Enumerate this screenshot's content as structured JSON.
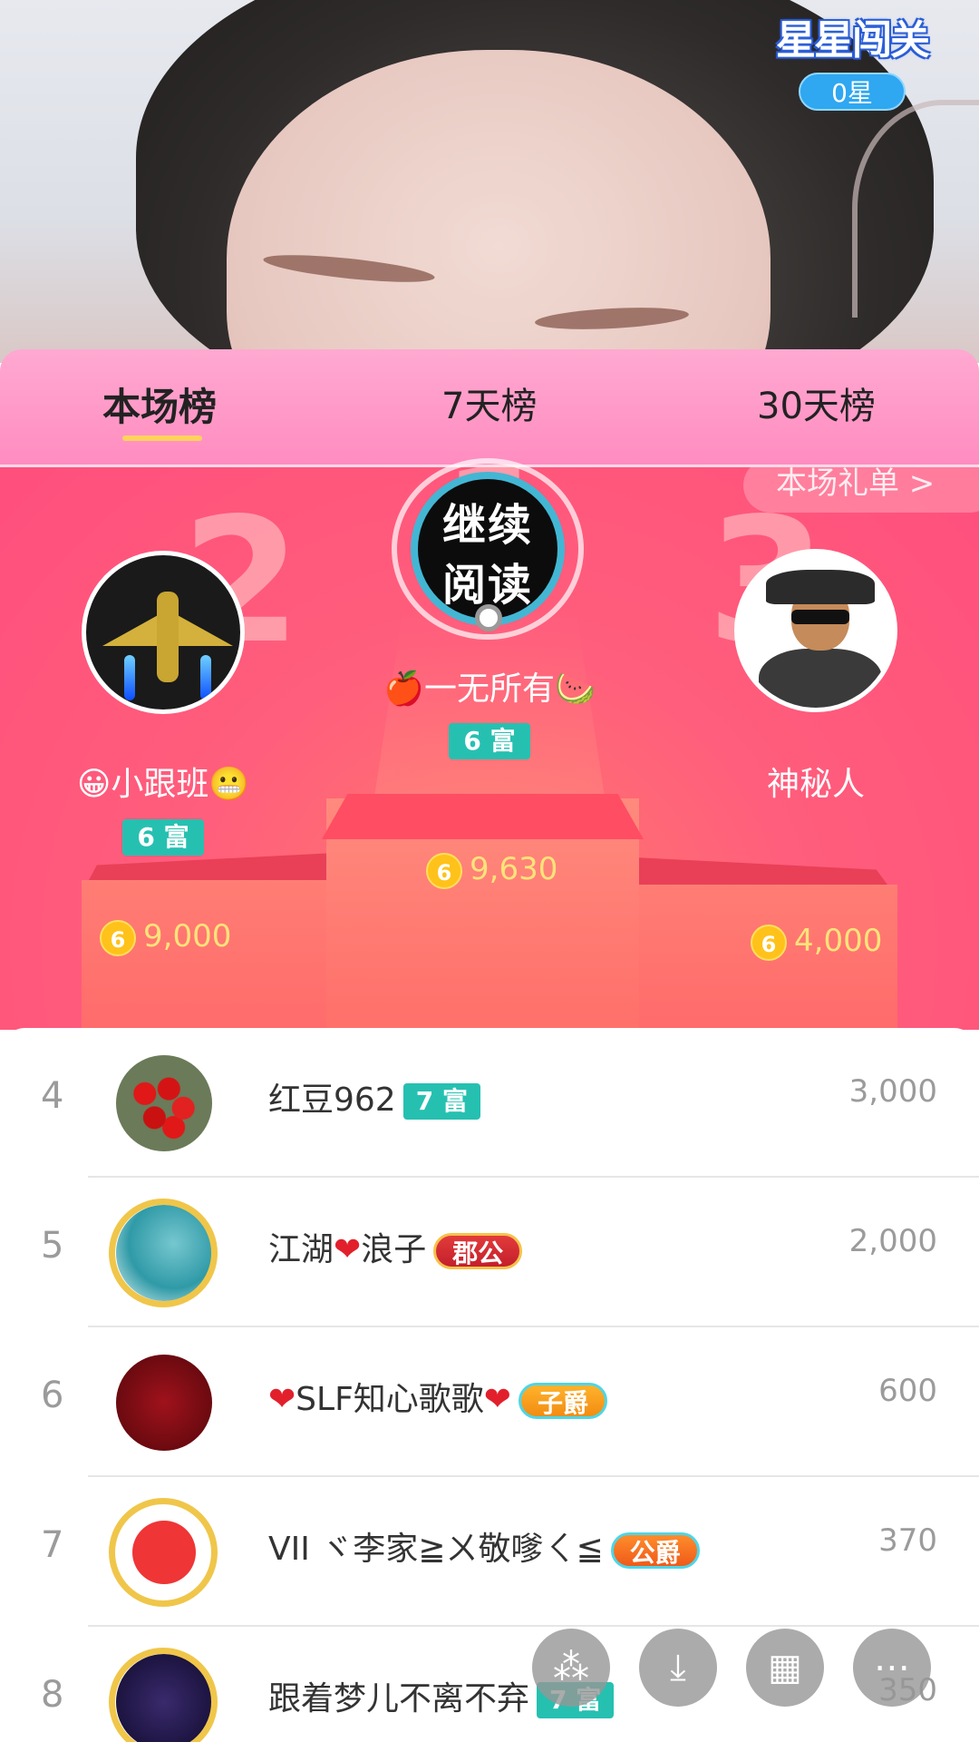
{
  "game": {
    "title": "星星闯关",
    "stars": "0星"
  },
  "tabs": [
    {
      "label": "本场榜"
    },
    {
      "label": "7天榜"
    },
    {
      "label": "30天榜"
    }
  ],
  "gift_link": "本场礼单 >",
  "podium": {
    "first": {
      "name": "🍎一无所有🍉",
      "level": "6 富",
      "coins": "9,630",
      "avatar_text": "继续\n阅读"
    },
    "second": {
      "name": "😀小跟班😬",
      "level": "6 富",
      "coins": "9,000"
    },
    "third": {
      "name": "神秘人",
      "coins": "4,000"
    },
    "coin_icon": "6",
    "big_numbers": [
      "1",
      "2",
      "3"
    ]
  },
  "rows": [
    {
      "rank": "4",
      "name": "红豆962",
      "tag": "7 富",
      "value": "3,000"
    },
    {
      "rank": "5",
      "name_a": "江湖",
      "name_b": "浪子",
      "tag": "郡公",
      "value": "2,000"
    },
    {
      "rank": "6",
      "name": "SLF知心歌歌",
      "tag": "子爵",
      "value": "600"
    },
    {
      "rank": "7",
      "name": "VII ヾ李家≧ㄨ敬嗲ㄑ≦",
      "tag": "公爵",
      "value": "370"
    },
    {
      "rank": "8",
      "name": "跟着梦儿不离不弃",
      "tag": "7 富",
      "value": "350"
    }
  ],
  "toolbar": [
    {
      "icon": "share-icon",
      "glyph": "⁂"
    },
    {
      "icon": "download-icon",
      "glyph": "⤓"
    },
    {
      "icon": "grid-icon",
      "glyph": "▦"
    },
    {
      "icon": "more-icon",
      "glyph": "⋯"
    }
  ]
}
